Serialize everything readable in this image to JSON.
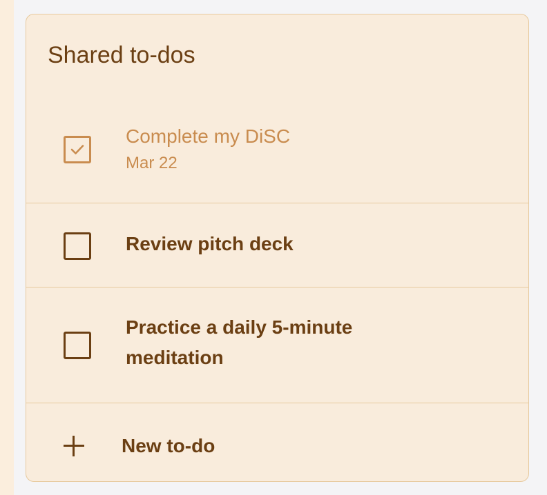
{
  "card": {
    "title": "Shared to-dos"
  },
  "todos": [
    {
      "text": "Complete my DiSC",
      "date": "Mar 22",
      "done": true
    },
    {
      "text": "Review pitch deck",
      "done": false
    },
    {
      "text": "Practice a daily 5-minute meditation",
      "done": false
    }
  ],
  "new_todo": {
    "label": "New to-do",
    "icon": "plus-icon"
  },
  "colors": {
    "text": "#6b3f13",
    "done_text": "#c98c4f",
    "card_background": "#f9ecdc",
    "border": "#e7c99d"
  }
}
